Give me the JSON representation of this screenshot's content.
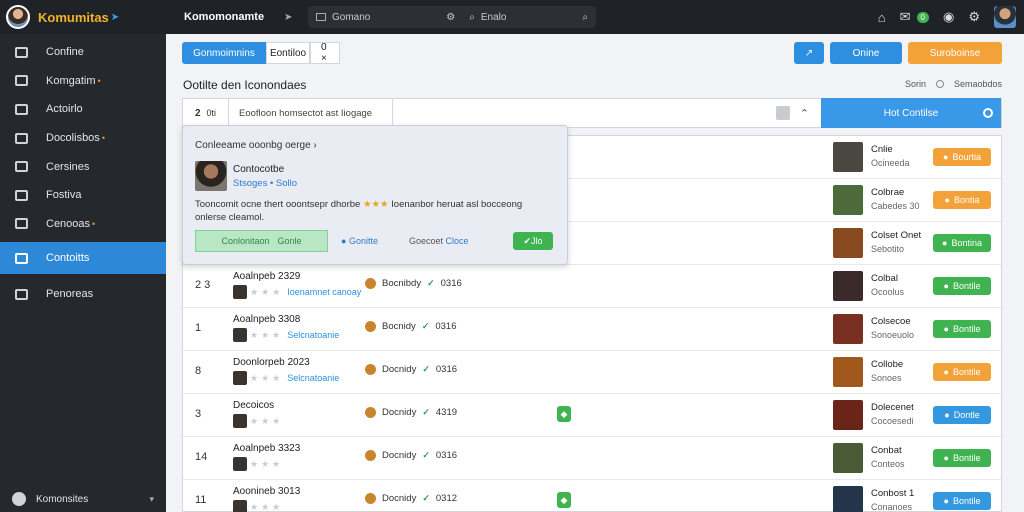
{
  "brand": {
    "name": "Komumitas"
  },
  "topbar": {
    "title": "Komomonamte",
    "search_text": "Gomano",
    "search_text2": "Enalo"
  },
  "sidebar": {
    "items": [
      {
        "label": "Confine",
        "dot": ""
      },
      {
        "label": "Komgatim",
        "dot": "•"
      },
      {
        "label": "Actoirlo",
        "dot": ""
      },
      {
        "label": "Docolisbos",
        "dot": "•"
      },
      {
        "label": "Cersines",
        "dot": ""
      },
      {
        "label": "Fostiva",
        "dot": ""
      },
      {
        "label": "Cenooas",
        "dot": "•"
      },
      {
        "label": "Contoitts",
        "dot": ""
      },
      {
        "label": "Penoreas",
        "dot": ""
      }
    ],
    "footer_label": "Komonsites"
  },
  "toolbar": {
    "tab_primary": "Gonmoimnins",
    "tab_2": "Eontiloo",
    "tab_3": "0 ×",
    "btn_right_1": "",
    "btn_online": "Onine",
    "btn_orange": "Suroboinse"
  },
  "main": {
    "section_title": "Ootilte den Iconondaes",
    "sort_label": "Sorin",
    "sort_value": "Semaobdos"
  },
  "filter": {
    "left_label": "2",
    "left_label2": "0ti",
    "text": "Eoofloon homsectot ast Iiogage",
    "cta": "Hot Contilse"
  },
  "popup": {
    "title": "Conleeame ooonbg oerge ›",
    "name": "Contocotbe",
    "sub": "Stsoges • Sollo",
    "desc_before": "Tooncomit ocne thert ooontsepr dhorbe",
    "desc_stars": "★★★",
    "desc_after": "Ioenanbor heruat asl bocceong onlerse cleamol.",
    "accept": "Conlonitaon",
    "accept2": "Gonle",
    "link1": "Gonitte",
    "link2": "Goecoet",
    "link2b": "Cloce",
    "ok": "Jlo"
  },
  "table": {
    "rows": [
      {
        "idx": "",
        "date": "",
        "meta": "",
        "num": "",
        "flag": false,
        "game": "Cnlie",
        "game_sub": "Ocineeda",
        "status": "Bourtia",
        "status_color": "orange",
        "gcolor": "#4a4640"
      },
      {
        "idx": "",
        "date": "",
        "meta": "",
        "num": "",
        "flag": false,
        "game": "Colbrae",
        "game_sub": "Cabedes 30",
        "status": "Bontia",
        "status_color": "orange",
        "gcolor": "#4f6a3a"
      },
      {
        "idx": "",
        "date": "",
        "meta": "",
        "num": "",
        "flag": false,
        "game": "Colset Onet",
        "game_sub": "Sebotito",
        "status": "Bontina",
        "status_color": "green",
        "gcolor": "#8a4a20"
      },
      {
        "idx": "2 3",
        "date": "Aoalnpeb 2329",
        "meta": "Bocnibdy",
        "num": "0316",
        "flag": false,
        "game": "Colbal",
        "game_sub": "Ocoolus",
        "status": "Bontile",
        "status_color": "green",
        "gcolor": "#3a2a2a",
        "tag": "Ioenamnet canoay"
      },
      {
        "idx": "1",
        "date": "Aoalnpeb 3308",
        "meta": "Bocnidy",
        "num": "0316",
        "flag": false,
        "game": "Colsecoe",
        "game_sub": "Sonoeuolo",
        "status": "Bontile",
        "status_color": "green",
        "gcolor": "#7a3020",
        "tag": "Selcnatoanie"
      },
      {
        "idx": "8",
        "date": "Doonlorpeb 2023",
        "meta": "Docnidy",
        "num": "0316",
        "flag": false,
        "game": "Collobe",
        "game_sub": "Sonoes",
        "status": "Bontile",
        "status_color": "orange",
        "gcolor": "#a0581c",
        "tag": "Selcnatoanie"
      },
      {
        "idx": "3",
        "date": "Decoicos",
        "meta": "Docnidy",
        "num": "4319",
        "flag": true,
        "game": "Dolecenet",
        "game_sub": "Cocoesedi",
        "status": "Dontle",
        "status_color": "blue",
        "gcolor": "#6a2418",
        "tag": ""
      },
      {
        "idx": "14",
        "date": "Aoalnpeb 3323",
        "meta": "Docnidy",
        "num": "0316",
        "flag": false,
        "game": "Conbat",
        "game_sub": "Conteos",
        "status": "Bontile",
        "status_color": "green",
        "gcolor": "#4a5a34",
        "tag": ""
      },
      {
        "idx": "11",
        "date": "Aoonineb 3013",
        "meta": "Docnidy",
        "num": "0312",
        "flag": true,
        "game": "Conbost 1",
        "game_sub": "Conanoes",
        "status": "Bontile",
        "status_color": "blue",
        "gcolor": "#24344a",
        "tag": ""
      }
    ]
  }
}
